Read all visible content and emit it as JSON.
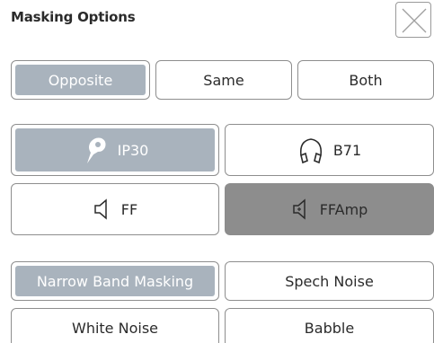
{
  "header": {
    "title": "Masking Options"
  },
  "ear_options": [
    {
      "label": "Opposite",
      "selected": true
    },
    {
      "label": "Same",
      "selected": false
    },
    {
      "label": "Both",
      "selected": false
    }
  ],
  "transducers": [
    {
      "label": "IP30",
      "icon": "insert-earphone-icon",
      "selected": true
    },
    {
      "label": "B71",
      "icon": "headphones-icon",
      "selected": false
    },
    {
      "label": "FF",
      "icon": "speaker-icon",
      "selected": false
    },
    {
      "label": "FFAmp",
      "icon": "amplified-speaker-icon",
      "selected": true
    }
  ],
  "noise_types": [
    {
      "label": "Narrow Band Masking",
      "selected": true
    },
    {
      "label": "Spech Noise",
      "selected": false
    },
    {
      "label": "White Noise",
      "selected": false
    },
    {
      "label": "Babble",
      "selected": false
    }
  ],
  "colors": {
    "selected_fill": "#a9b3bd",
    "selected_dark": "#8d8d8d",
    "border": "#8e8e8e"
  }
}
